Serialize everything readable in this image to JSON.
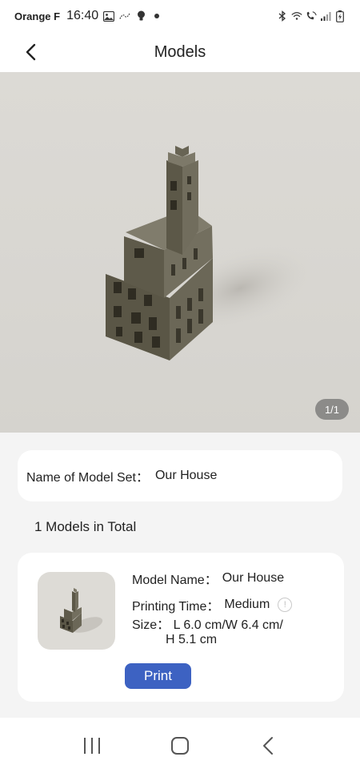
{
  "status_bar": {
    "carrier": "Orange F",
    "time": "16:40",
    "icons": [
      "gallery-icon",
      "call-icon",
      "lightbulb-icon",
      "dot-icon",
      "bluetooth-icon",
      "wifi-icon",
      "wifi-calling-icon",
      "signal-icon",
      "battery-icon"
    ]
  },
  "header": {
    "title": "Models",
    "back_icon": "chevron-left-icon"
  },
  "hero": {
    "image_subject": "3D printed pixel-art house model",
    "counter": "1/1"
  },
  "model_set": {
    "label": "Name of Model Set：",
    "value": "Our House"
  },
  "models_total": "1 Models in Total",
  "model_card": {
    "name_label": "Model Name：",
    "name_value": "Our House",
    "time_label": "Printing Time：",
    "time_value": "Medium",
    "size_label": "Size：",
    "size_line1": "L 6.0 cm/W 6.4 cm/",
    "size_line2": "H 5.1 cm",
    "print_label": "Print"
  },
  "nav": {
    "items": [
      "recent-apps-icon",
      "home-icon",
      "back-icon"
    ]
  },
  "colors": {
    "accent": "#3d62c2",
    "background": "#f4f4f4",
    "card": "#ffffff",
    "model": "#5e5a4a"
  }
}
